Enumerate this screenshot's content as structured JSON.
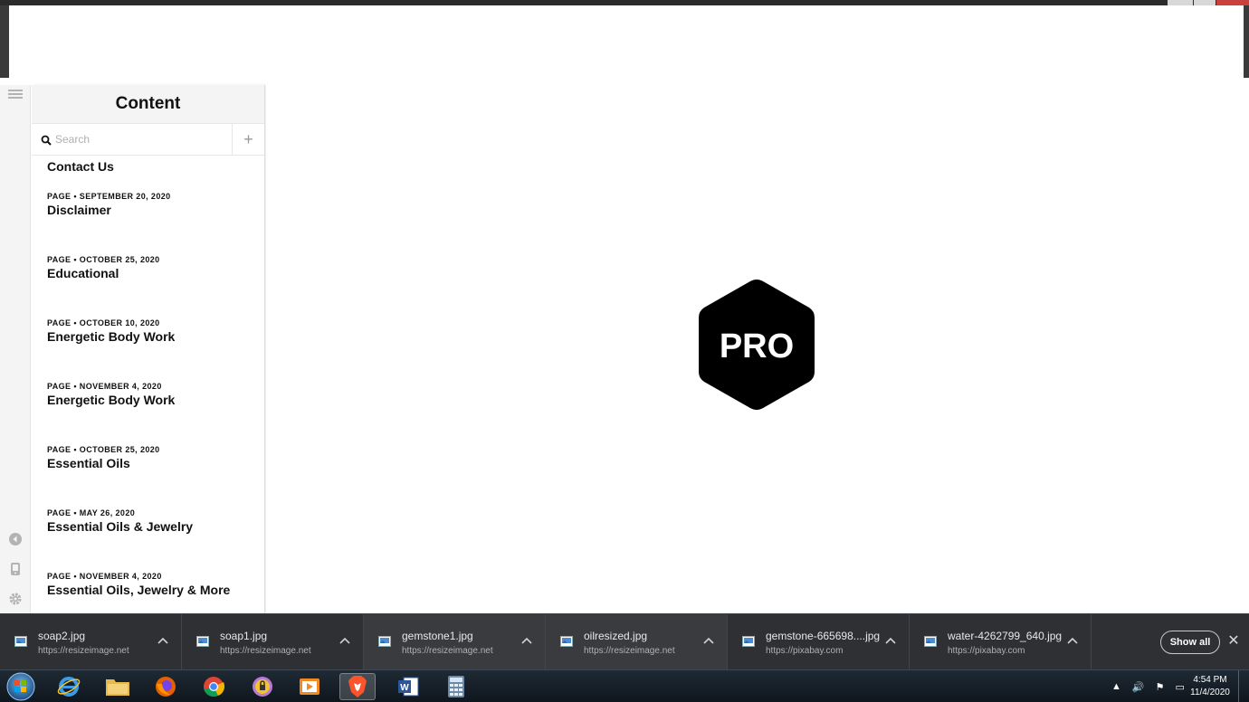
{
  "content_panel": {
    "title": "Content",
    "search_placeholder": "Search",
    "add_label": "+"
  },
  "items": [
    {
      "meta": "",
      "title": "Contact Us"
    },
    {
      "meta": "PAGE • SEPTEMBER 20, 2020",
      "title": "Disclaimer"
    },
    {
      "meta": "PAGE • OCTOBER 25, 2020",
      "title": "Educational"
    },
    {
      "meta": "PAGE • OCTOBER 10, 2020",
      "title": "Energetic Body Work"
    },
    {
      "meta": "PAGE • NOVEMBER 4, 2020",
      "title": "Energetic Body Work"
    },
    {
      "meta": "PAGE • OCTOBER 25, 2020",
      "title": "Essential Oils"
    },
    {
      "meta": "PAGE • MAY 26, 2020",
      "title": "Essential Oils & Jewelry"
    },
    {
      "meta": "PAGE • NOVEMBER 4, 2020",
      "title": "Essential Oils, Jewelry & More"
    }
  ],
  "preview": {
    "logo_text": "PRO"
  },
  "downloads": {
    "items": [
      {
        "name": "soap2.jpg",
        "url": "https://resizeimage.net"
      },
      {
        "name": "soap1.jpg",
        "url": "https://resizeimage.net"
      },
      {
        "name": "gemstone1.jpg",
        "url": "https://resizeimage.net"
      },
      {
        "name": "oilresized.jpg",
        "url": "https://resizeimage.net"
      },
      {
        "name": "gemstone-665698....jpg",
        "url": "https://pixabay.com"
      },
      {
        "name": "water-4262799_640.jpg",
        "url": "https://pixabay.com"
      }
    ],
    "show_all_label": "Show all",
    "close_label": "✕"
  },
  "taskbar": {
    "apps": [
      "internet-explorer-icon",
      "file-explorer-icon",
      "firefox-icon",
      "chrome-icon",
      "keeper-icon",
      "media-player-icon",
      "brave-icon",
      "word-icon",
      "calculator-icon"
    ],
    "clock_time": "4:54 PM",
    "clock_date": "11/4/2020"
  }
}
